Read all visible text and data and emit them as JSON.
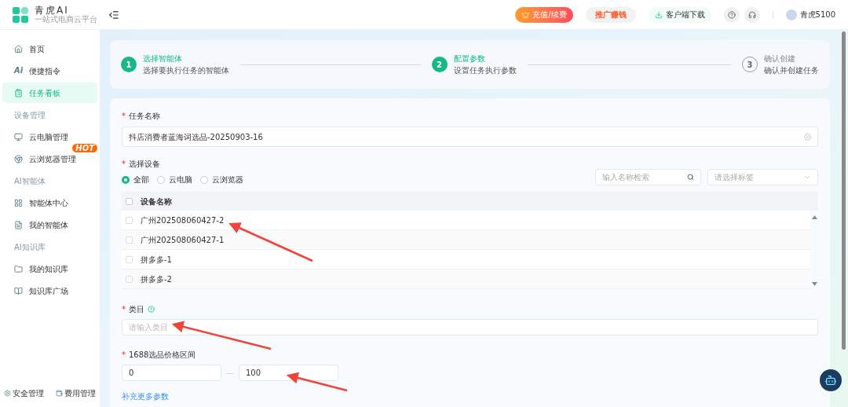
{
  "header": {
    "brand": "青虎AI",
    "tagline": "一站式电商云平台",
    "recharge": "充值/续费",
    "promote": "推广赚钱",
    "download": "客户端下载",
    "user": "青虎5100"
  },
  "sidebar": {
    "items": [
      {
        "kind": "item",
        "label": "首页",
        "selected": false
      },
      {
        "kind": "item",
        "label": "便捷指令",
        "selected": false,
        "icon_text": "Ai"
      },
      {
        "kind": "item",
        "label": "任务看板",
        "selected": true
      },
      {
        "kind": "section",
        "label": "设备管理"
      },
      {
        "kind": "item",
        "label": "云电脑管理",
        "selected": false
      },
      {
        "kind": "item",
        "label": "云浏览器管理",
        "selected": false,
        "badge": "HOT"
      },
      {
        "kind": "section",
        "label": "AI智能体"
      },
      {
        "kind": "item",
        "label": "智能体中心",
        "selected": false
      },
      {
        "kind": "item",
        "label": "我的智能体",
        "selected": false
      },
      {
        "kind": "section",
        "label": "AI知识库"
      },
      {
        "kind": "item",
        "label": "我的知识库",
        "selected": false
      },
      {
        "kind": "item",
        "label": "知识库广场",
        "selected": false
      }
    ],
    "footer": [
      "安全管理",
      "费用管理"
    ]
  },
  "steps": [
    {
      "number": "1",
      "title": "选择智能体",
      "subtitle": "选择要执行任务的智能体",
      "active": true
    },
    {
      "number": "2",
      "title": "配置参数",
      "subtitle": "设置任务执行参数",
      "active": true
    },
    {
      "number": "3",
      "title": "确认创建",
      "subtitle": "确认并创建任务",
      "active": false
    }
  ],
  "form": {
    "task_name": {
      "required_mark": "*",
      "label": "任务名称",
      "value": "抖店消费者蓝海词选品-20250903-16"
    },
    "device": {
      "required_mark": "*",
      "label": "选择设备",
      "options": [
        {
          "label": "全部",
          "selected": true
        },
        {
          "label": "云电脑",
          "selected": false
        },
        {
          "label": "云浏览器",
          "selected": false
        }
      ],
      "search": {
        "placeholder": "输入名称检索"
      },
      "tag_select": {
        "placeholder": "请选择标签"
      },
      "table": {
        "columns": [
          "设备名称"
        ],
        "all_checked": false,
        "rows": [
          {
            "name": "广州202508060427-2",
            "checked": false
          },
          {
            "name": "广州202508060427-1",
            "checked": false
          },
          {
            "name": "拼多多-1",
            "checked": false
          },
          {
            "name": "拼多多-2",
            "checked": false
          }
        ]
      }
    },
    "category": {
      "required_mark": "*",
      "label": "类目",
      "placeholder": "请输入类目"
    },
    "price_range": {
      "required_mark": "*",
      "label": "1688选品价格区间",
      "min": "0",
      "separator": "—",
      "max": "100"
    },
    "more_link": "补充更多参数"
  }
}
